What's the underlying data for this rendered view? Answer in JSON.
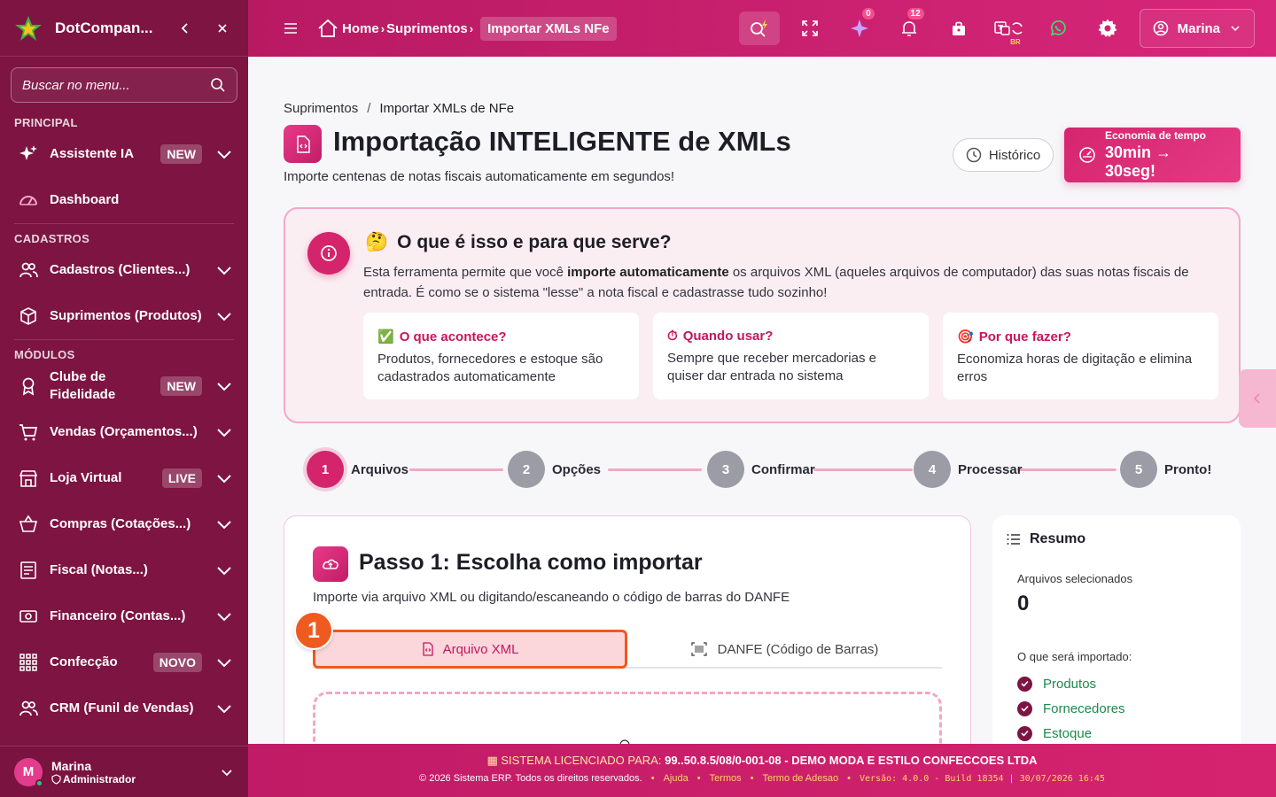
{
  "sidebar": {
    "brand": "DotCompan...",
    "search_placeholder": "Buscar no menu...",
    "sections": {
      "principal": "PRINCIPAL",
      "cadastros": "CADASTROS",
      "modulos": "MÓDULOS"
    },
    "items": {
      "assistente": {
        "label": "Assistente IA",
        "badge": "NEW"
      },
      "dashboard": {
        "label": "Dashboard"
      },
      "cadastros": {
        "label": "Cadastros (Clientes...)"
      },
      "suprimentos": {
        "label": "Suprimentos (Produtos)"
      },
      "fidelidade": {
        "label": "Clube de Fidelidade",
        "badge": "NEW"
      },
      "vendas": {
        "label": "Vendas (Orçamentos...)"
      },
      "loja": {
        "label": "Loja Virtual",
        "badge": "LIVE"
      },
      "compras": {
        "label": "Compras (Cotações...)"
      },
      "fiscal": {
        "label": "Fiscal (Notas...)"
      },
      "financeiro": {
        "label": "Financeiro (Contas...)"
      },
      "confeccao": {
        "label": "Confecção",
        "badge": "NOVO"
      },
      "crm": {
        "label": "CRM (Funil de Vendas)"
      }
    },
    "user": {
      "initial": "M",
      "name": "Marina",
      "role": "Administrador"
    }
  },
  "topbar": {
    "crumb_home": "Home",
    "crumb_mid": "Suprimentos",
    "crumb_current": "Importar XMLs NFe",
    "ai_count": "0",
    "notif_count": "12",
    "lang_tag": "BR",
    "user_name": "Marina"
  },
  "page": {
    "breadcrumb_parent": "Suprimentos",
    "breadcrumb_sep": "/",
    "breadcrumb_current": "Importar XMLs de NFe",
    "title": "Importação INTELIGENTE de XMLs",
    "subtitle": "Importe centenas de notas fiscais automaticamente em segundos!",
    "history_button": "Histórico",
    "economy_label": "Economia de tempo",
    "economy_value": "30min → 30seg!"
  },
  "info": {
    "emoji": "🤔",
    "heading": "O que é isso e para que serve?",
    "text_before": "Esta ferramenta permite que você ",
    "text_bold": "importe automaticamente",
    "text_after": " os arquivos XML (aqueles arquivos de computador) das suas notas fiscais de entrada. É como se o sistema \"lesse\" a nota fiscal e cadastrasse tudo sozinho!",
    "cards": [
      {
        "icon": "✅",
        "title": "O que acontece?",
        "text": "Produtos, fornecedores e estoque são cadastrados automaticamente"
      },
      {
        "icon": "⏱",
        "title": "Quando usar?",
        "text": "Sempre que receber mercadorias e quiser dar entrada no sistema"
      },
      {
        "icon": "🎯",
        "title": "Por que fazer?",
        "text": "Economiza horas de digitação e elimina erros"
      }
    ]
  },
  "steps": [
    {
      "num": "1",
      "label": "Arquivos"
    },
    {
      "num": "2",
      "label": "Opções"
    },
    {
      "num": "3",
      "label": "Confirmar"
    },
    {
      "num": "4",
      "label": "Processar"
    },
    {
      "num": "5",
      "label": "Pronto!"
    }
  ],
  "step1": {
    "title": "Passo 1: Escolha como importar",
    "subtitle": "Importe via arquivo XML ou digitando/escaneando o código de barras do DANFE",
    "tab_xml": "Arquivo XML",
    "tab_danfe": "DANFE (Código de Barras)",
    "marker": "1"
  },
  "resumo": {
    "title": "Resumo",
    "files_label": "Arquivos selecionados",
    "files_value": "0",
    "import_label": "O que será importado:",
    "items": [
      "Produtos",
      "Fornecedores",
      "Estoque"
    ]
  },
  "footer": {
    "license_label": "SISTEMA LICENCIADO PARA:",
    "license_value": "99..50.8.5/08/0-001-08 - DEMO MODA E ESTILO CONFECCOES LTDA",
    "copyright": "© 2026 Sistema ERP. Todos os direitos reservados.",
    "links": [
      "Ajuda",
      "Termos",
      "Termo de Adesao"
    ],
    "version": "Versão: 4.0.0 - Build 18354 | 30/07/2026 16:45"
  },
  "colors": {
    "primary": "#d4246c",
    "sidebar": "#7d1442",
    "highlight": "#ee5a1f"
  }
}
